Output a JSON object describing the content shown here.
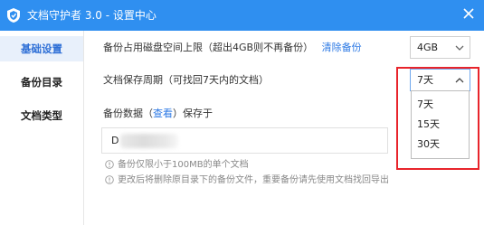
{
  "window": {
    "title": "文档守护者 3.0 - 设置中心"
  },
  "sidebar": {
    "items": [
      {
        "label": "基础设置",
        "active": true
      },
      {
        "label": "备份目录",
        "active": false
      },
      {
        "label": "文档类型",
        "active": false
      }
    ]
  },
  "settings": {
    "disk_limit": {
      "label": "备份占用磁盘空间上限（超出4GB则不再备份）",
      "clear_link": "清除备份",
      "value": "4GB"
    },
    "retention": {
      "label": "文档保存周期（可找回7天内的文档）",
      "value": "7天",
      "options": [
        "7天",
        "15天",
        "30天"
      ]
    },
    "backup_location": {
      "label_prefix": "备份数据（",
      "view_link": "查看",
      "label_suffix": "）保存于",
      "path_value": "D"
    },
    "notices": [
      "备份仅限小于100MB的单个文档",
      "更改后将删除原目录下的备份文件，重要备份请先使用文档找回导出"
    ]
  },
  "colors": {
    "titlebar": "#2f8ff0",
    "accent": "#2b78e4",
    "highlight": "#e8242b",
    "sidebar_active_bg": "#e8f0fb"
  },
  "icons": {
    "app": "shield-icon",
    "close": "close-icon",
    "dropdown": "chevron-icon",
    "notice": "info-circle-icon"
  }
}
